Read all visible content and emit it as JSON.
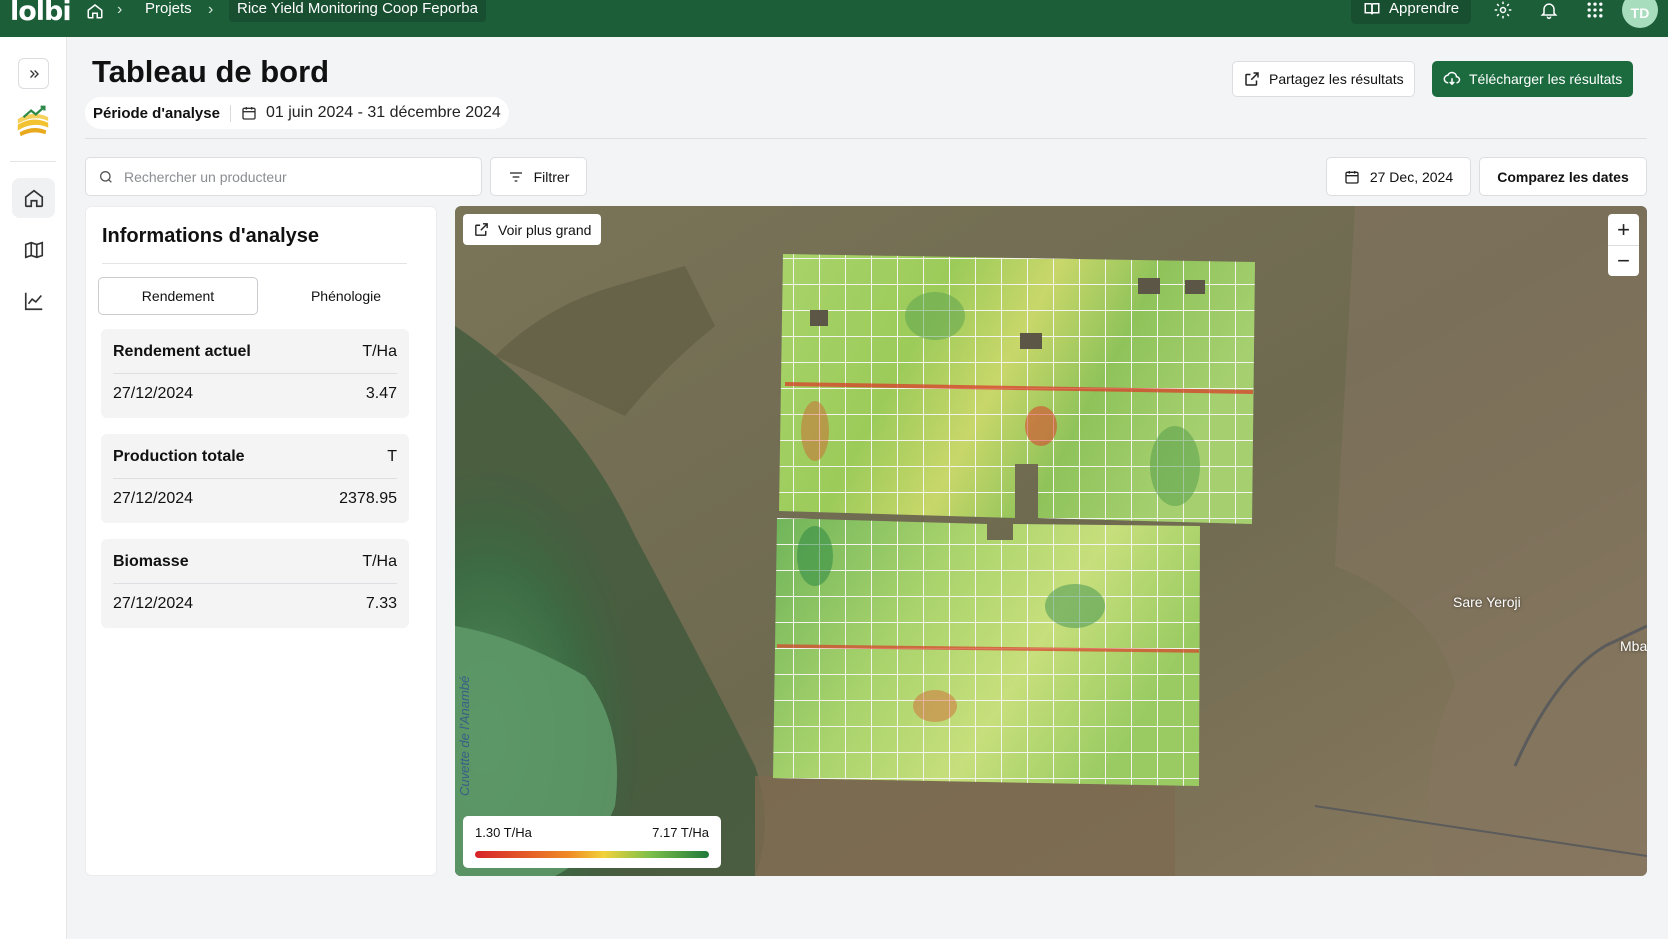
{
  "topbar": {
    "logo": "lolbi",
    "breadcrumb": [
      "Projets",
      "Rice Yield Monitoring Coop Feporba"
    ],
    "learn_label": "Apprendre",
    "avatar_initials": "TD"
  },
  "header": {
    "title": "Tableau de bord",
    "period_label": "Période d'analyse",
    "period_range": "01 juin 2024 - 31 décembre 2024",
    "share_label": "Partagez les résultats",
    "download_label": "Télécharger les résultats"
  },
  "toolbar": {
    "search_placeholder": "Rechercher un producteur",
    "filter_label": "Filtrer",
    "date_label": "27 Dec, 2024",
    "compare_label": "Comparez les dates"
  },
  "panel": {
    "title": "Informations d'analyse",
    "tabs": [
      "Rendement",
      "Phénologie"
    ],
    "active_tab": "Rendement",
    "cards": [
      {
        "name": "Rendement actuel",
        "unit": "T/Ha",
        "date": "27/12/2024",
        "value": "3.47"
      },
      {
        "name": "Production totale",
        "unit": "T",
        "date": "27/12/2024",
        "value": "2378.95"
      },
      {
        "name": "Biomasse",
        "unit": "T/Ha",
        "date": "27/12/2024",
        "value": "7.33"
      }
    ]
  },
  "map": {
    "expand_label": "Voir plus grand",
    "zoom_in": "+",
    "zoom_out": "−",
    "legend_min": "1.30 T/Ha",
    "legend_max": "7.17 T/Ha",
    "place_labels": [
      "Sare Yeroji",
      "Mba",
      "Cuvette de l'Anambé"
    ],
    "legend_colors": [
      "#d6232a",
      "#f08a24",
      "#f2d23a",
      "#7bbf4a",
      "#1f7a3a"
    ]
  },
  "colors": {
    "brand_green": "#1b5e38",
    "button_green": "#1b6b3f"
  }
}
